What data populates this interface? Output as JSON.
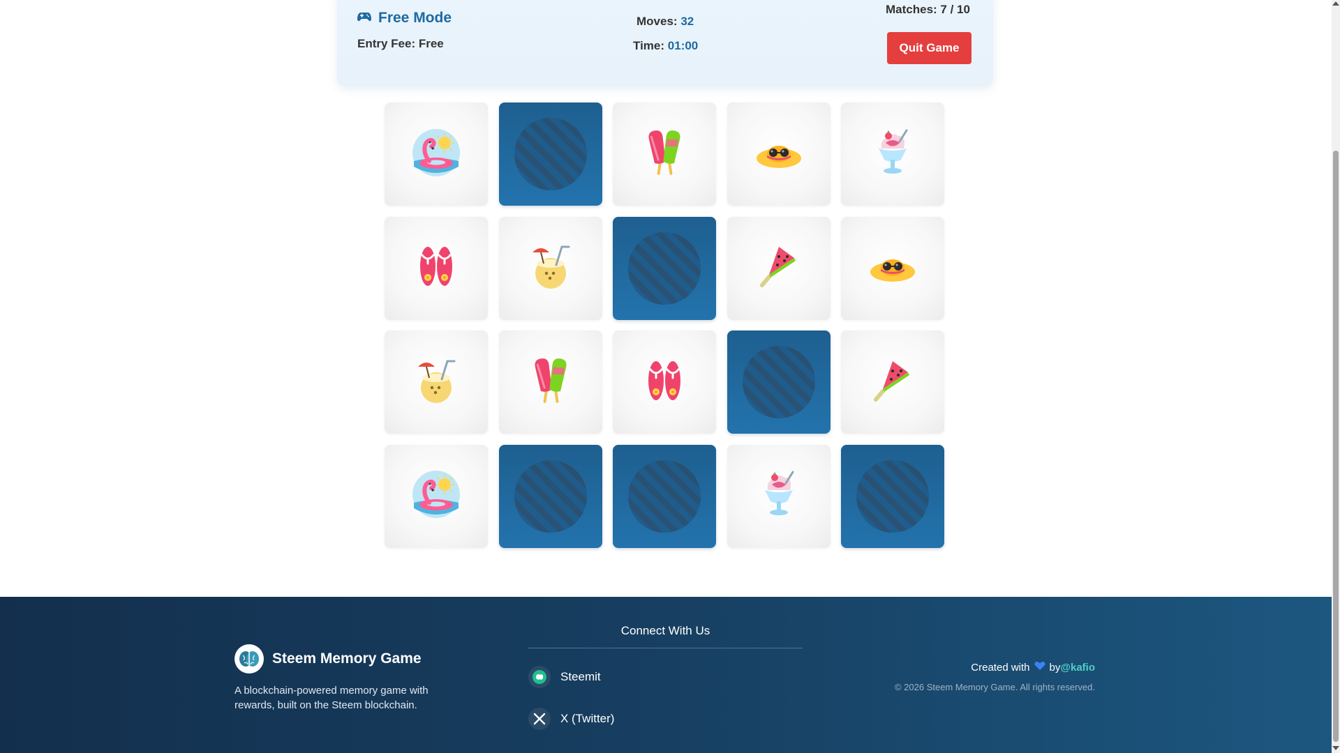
{
  "header": {
    "mode_label": "Free Mode",
    "mode_icon": "gamepad-icon",
    "entry_fee": "Entry Fee: Free",
    "moves_label": "Moves:",
    "moves_value": "32",
    "time_label": "Time:",
    "time_value": "01:00",
    "matches": "Matches: 7 / 10",
    "quit_label": "Quit Game"
  },
  "board": {
    "rows": 4,
    "cols": 5,
    "cards": [
      {
        "state": "up",
        "icon": "flamingo-float-icon"
      },
      {
        "state": "down",
        "icon": "card-back-icon"
      },
      {
        "state": "up",
        "icon": "popsicles-icon"
      },
      {
        "state": "up",
        "icon": "sun-hat-icon"
      },
      {
        "state": "up",
        "icon": "shaved-ice-icon"
      },
      {
        "state": "up",
        "icon": "flip-flops-icon"
      },
      {
        "state": "up",
        "icon": "coconut-drink-icon"
      },
      {
        "state": "down",
        "icon": "card-back-icon"
      },
      {
        "state": "up",
        "icon": "watermelon-pop-icon"
      },
      {
        "state": "up",
        "icon": "sun-hat-icon"
      },
      {
        "state": "up",
        "icon": "coconut-drink-icon"
      },
      {
        "state": "up",
        "icon": "popsicles-icon"
      },
      {
        "state": "up",
        "icon": "flip-flops-icon"
      },
      {
        "state": "down",
        "icon": "card-back-icon"
      },
      {
        "state": "up",
        "icon": "watermelon-pop-icon"
      },
      {
        "state": "up",
        "icon": "flamingo-float-icon"
      },
      {
        "state": "down",
        "icon": "card-back-icon"
      },
      {
        "state": "down",
        "icon": "card-back-icon"
      },
      {
        "state": "up",
        "icon": "shaved-ice-icon"
      },
      {
        "state": "down",
        "icon": "card-back-icon"
      }
    ]
  },
  "footer": {
    "brand_name": "Steem Memory Game",
    "brand_icon": "brain-icon",
    "brand_desc": "A blockchain-powered memory game with rewards, built on the Steem blockchain.",
    "connect_title": "Connect With Us",
    "socials": [
      {
        "label": "Steemit",
        "icon": "steemit-icon"
      },
      {
        "label": "X (Twitter)",
        "icon": "x-twitter-icon"
      }
    ],
    "credit_prefix": "Created with",
    "credit_icon": "heart-icon",
    "credit_by": "by",
    "credit_handle": "@kafio",
    "copyright": "© 2026 Steem Memory Game. All rights reserved."
  },
  "colors": {
    "accent": "#1e6aa0",
    "quit": "#e53e3e",
    "card_back": "#2373ad",
    "footer_bg": "#173f61",
    "handle": "#4fd1c5"
  }
}
